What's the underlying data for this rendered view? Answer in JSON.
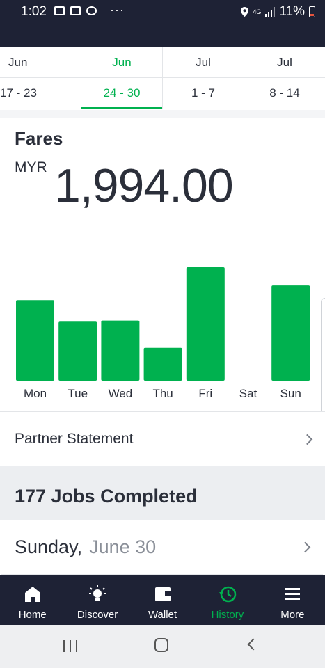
{
  "status_bar": {
    "time": "1:02",
    "dots": "···",
    "network": "4G",
    "battery": "11%"
  },
  "week_tabs": [
    {
      "month": "Jun",
      "range": "17 - 23",
      "active": false
    },
    {
      "month": "Jun",
      "range": "24 - 30",
      "active": true
    },
    {
      "month": "Jul",
      "range": "1 - 7",
      "active": false
    },
    {
      "month": "Jul",
      "range": "8 - 14",
      "active": false
    }
  ],
  "fares": {
    "title": "Fares",
    "currency": "MYR",
    "amount": "1,994.00"
  },
  "chart_data": {
    "type": "bar",
    "title": "",
    "categories": [
      "Mon",
      "Tue",
      "Wed",
      "Thu",
      "Fri",
      "Sat",
      "Sun"
    ],
    "values": [
      71,
      52,
      53,
      29,
      100,
      0,
      84
    ],
    "ylim": [
      0,
      100
    ],
    "grid": false,
    "bar_color": "#00b14f"
  },
  "partner_statement": {
    "label": "Partner Statement"
  },
  "jobs": {
    "title": "177 Jobs Completed"
  },
  "day_row": {
    "day": "Sunday,",
    "date": "June 30"
  },
  "bottom_nav": [
    {
      "label": "Home",
      "icon": "home-icon",
      "active": false
    },
    {
      "label": "Discover",
      "icon": "lightbulb-icon",
      "active": false
    },
    {
      "label": "Wallet",
      "icon": "wallet-icon",
      "active": false
    },
    {
      "label": "History",
      "icon": "history-icon",
      "active": true
    },
    {
      "label": "More",
      "icon": "menu-icon",
      "active": false
    }
  ],
  "colors": {
    "accent": "#00b14f",
    "dark": "#1e2235"
  }
}
